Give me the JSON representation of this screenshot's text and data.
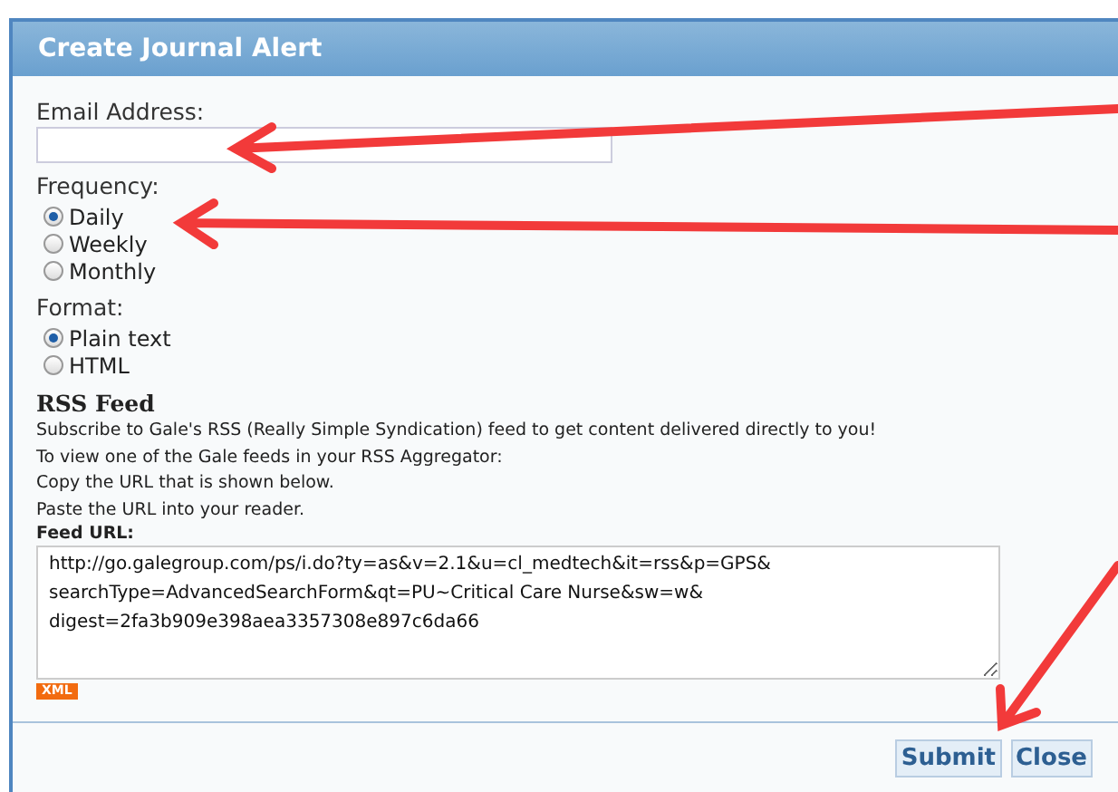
{
  "window": {
    "title": "Create Journal Alert"
  },
  "email": {
    "label": "Email Address:"
  },
  "frequency": {
    "label": "Frequency:",
    "options": [
      {
        "label": "Daily",
        "selected": true
      },
      {
        "label": "Weekly",
        "selected": false
      },
      {
        "label": "Monthly",
        "selected": false
      }
    ]
  },
  "format": {
    "label": "Format:",
    "options": [
      {
        "label": "Plain text",
        "selected": true
      },
      {
        "label": "HTML",
        "selected": false
      }
    ]
  },
  "rss": {
    "heading": "RSS Feed",
    "lines": [
      "Subscribe to Gale's RSS (Really Simple Syndication) feed to get content delivered directly to you!",
      "To view one of the Gale feeds in your RSS Aggregator:",
      "Copy the URL that is shown below.",
      "Paste the URL into your reader."
    ],
    "url_label": "Feed URL:",
    "url": "http://go.galegroup.com/ps/i.do?ty=as&v=2.1&u=cl_medtech&it=rss&p=GPS&\nsearchType=AdvancedSearchForm&qt=PU~Critical Care Nurse&sw=w&\ndigest=2fa3b909e398aea3357308e897c6da66",
    "badge": "XML"
  },
  "buttons": [
    "Submit",
    "Close"
  ]
}
